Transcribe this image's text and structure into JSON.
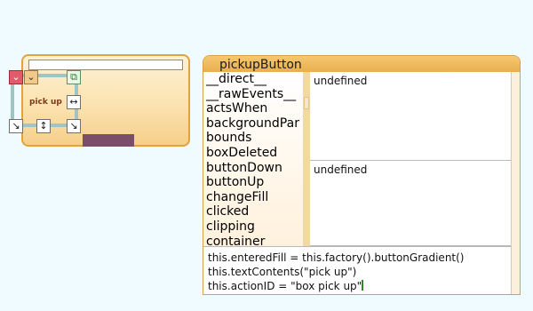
{
  "morph": {
    "label": "pick up",
    "halo_icons": [
      "chevron-down-icon",
      "chevron-down-icon",
      "copy-icon",
      "resize-horizontal-icon",
      "pickup-icon",
      "resize-vertical-icon",
      "resize-diagonal-icon"
    ]
  },
  "inspector": {
    "title": "pickupButton",
    "slots": [
      "__direct__",
      "__rawEvents__",
      "actsWhen",
      "backgroundPar",
      "bounds",
      "boxDeleted",
      "buttonDown",
      "buttonUp",
      "changeFill",
      "clicked",
      "clipping",
      "container"
    ],
    "value_top": "undefined",
    "value_bottom": "undefined",
    "code": [
      "this.enteredFill = this.factory().buttonGradient()",
      "this.textContents(\"pick up\")",
      "this.actionID = \"box pick up\""
    ]
  },
  "colors": {
    "background": "#f0fbff",
    "morph_border": "#e2a23c",
    "title_bar": "#f6c86f",
    "bar_fill": "#7a4d6a"
  }
}
